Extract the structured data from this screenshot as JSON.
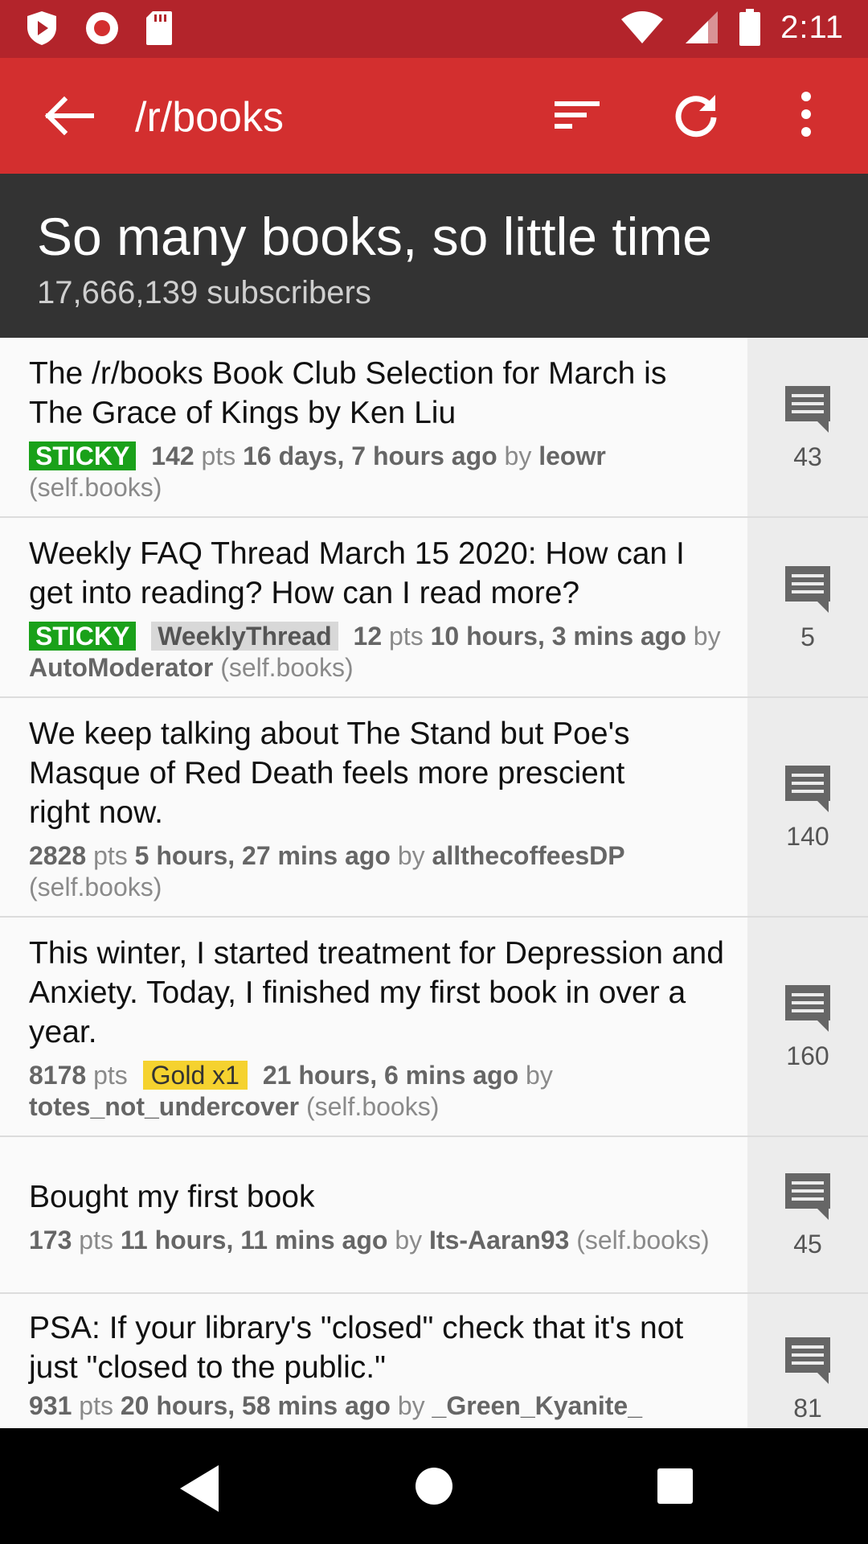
{
  "status_bar": {
    "time": "2:11",
    "icons": [
      "shield-play-icon",
      "record-icon",
      "sd-card-icon",
      "wifi-icon",
      "signal-icon",
      "battery-icon"
    ]
  },
  "app_bar": {
    "title": "/r/books",
    "icons": [
      "back-arrow-icon",
      "sort-icon",
      "refresh-icon",
      "more-vert-icon"
    ]
  },
  "header": {
    "title": "So many books, so little time",
    "subscribers": "17,666,139 subscribers"
  },
  "posts": [
    {
      "title": "The /r/books Book Club Selection for March is The Grace of Kings by Ken Liu",
      "sticky": "STICKY",
      "points": "142",
      "pts_label": "pts",
      "time": "16 days, 7 hours ago",
      "by": "by",
      "author": "leowr",
      "domain": "(self.books)",
      "comments": "43"
    },
    {
      "title": "Weekly FAQ Thread March 15 2020: How can I get into reading? How can I read more?",
      "sticky": "STICKY",
      "flair": "WeeklyThread",
      "points": "12",
      "pts_label": "pts",
      "time": "10 hours, 3 mins ago",
      "by": "by",
      "author": "AutoModerator",
      "domain": "(self.books)",
      "comments": "5"
    },
    {
      "title": "We keep talking about The Stand but Poe's Masque of Red Death feels more prescient right now.",
      "points": "2828",
      "pts_label": "pts",
      "time": "5 hours, 27 mins ago",
      "by": "by",
      "author": "allthecoffeesDP",
      "domain": "(self.books)",
      "comments": "140"
    },
    {
      "title": "This winter, I started treatment for Depression and Anxiety. Today, I finished my first book in over a year.",
      "points": "8178",
      "pts_label": "pts",
      "gold": "Gold x1",
      "time": "21 hours, 6 mins ago",
      "by": "by",
      "author": "totes_not_undercover",
      "domain": "(self.books)",
      "comments": "160"
    },
    {
      "title": "Bought my first book",
      "points": "173",
      "pts_label": "pts",
      "time": "11 hours, 11 mins ago",
      "by": "by",
      "author": "Its-Aaran93",
      "domain": "(self.books)",
      "comments": "45"
    },
    {
      "title": "PSA: If your library's \"closed\" check that it's not just \"closed to the public.\"",
      "points": "931",
      "pts_label": "pts",
      "time": "20 hours, 58 mins ago",
      "by": "by",
      "author": "_Green_Kyanite_",
      "domain": "",
      "comments": "81"
    }
  ],
  "nav_bar": {
    "icons": [
      "nav-back-icon",
      "nav-home-icon",
      "nav-recents-icon"
    ]
  },
  "colors": {
    "status_bar": "#b3242b",
    "app_bar": "#d32f2f",
    "header": "#333333",
    "sticky": "#1aa11a",
    "gold": "#f5d22f"
  }
}
